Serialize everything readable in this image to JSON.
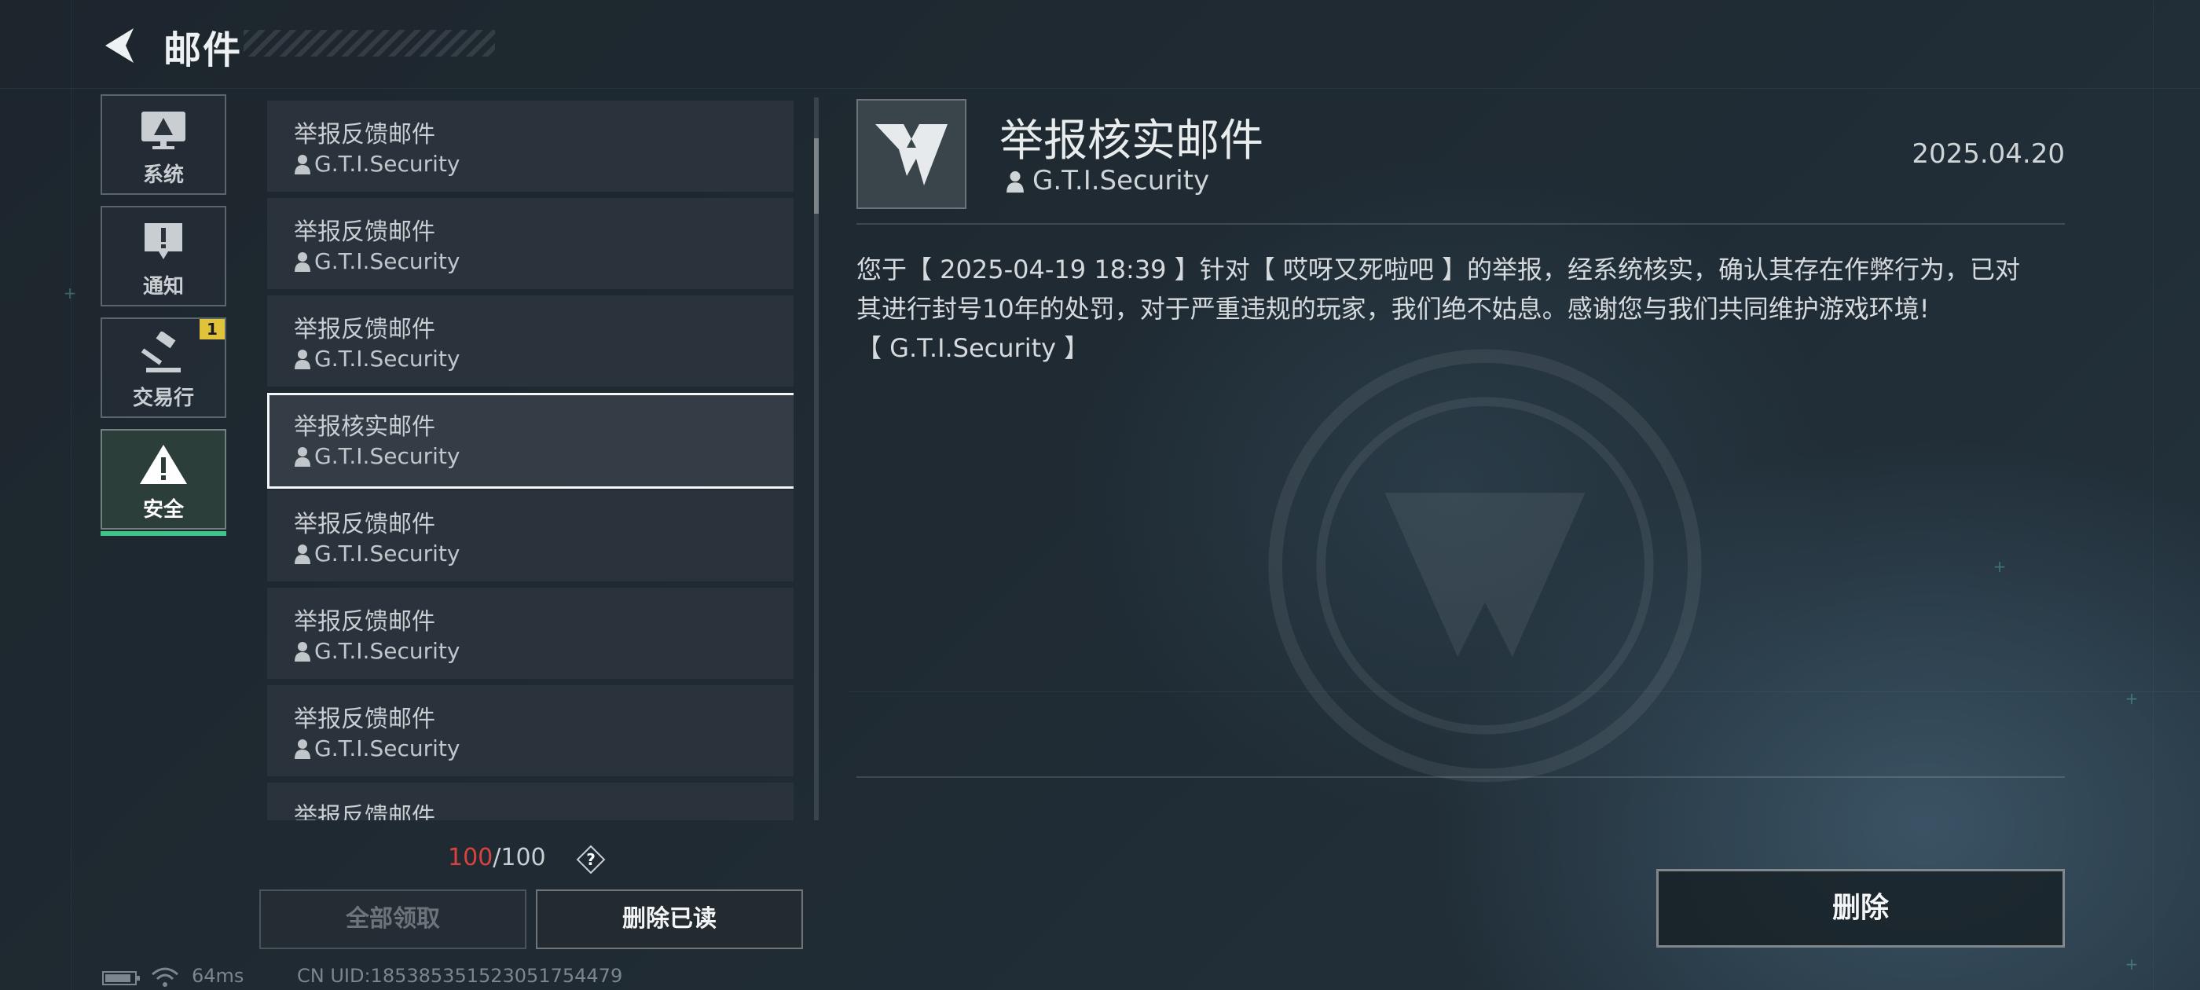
{
  "header": {
    "title": "邮件"
  },
  "categories": [
    {
      "label": "系统",
      "icon": "monitor-icon"
    },
    {
      "label": "通知",
      "icon": "notice-icon"
    },
    {
      "label": "交易行",
      "icon": "gavel-icon",
      "badge": "1"
    },
    {
      "label": "安全",
      "icon": "warning-icon",
      "active": true
    }
  ],
  "mail_list": [
    {
      "subject": "举报反馈邮件",
      "sender": "G.T.I.Security"
    },
    {
      "subject": "举报反馈邮件",
      "sender": "G.T.I.Security"
    },
    {
      "subject": "举报反馈邮件",
      "sender": "G.T.I.Security"
    },
    {
      "subject": "举报核实邮件",
      "sender": "G.T.I.Security",
      "selected": true
    },
    {
      "subject": "举报反馈邮件",
      "sender": "G.T.I.Security"
    },
    {
      "subject": "举报反馈邮件",
      "sender": "G.T.I.Security"
    },
    {
      "subject": "举报反馈邮件",
      "sender": "G.T.I.Security"
    },
    {
      "subject": "举报反馈邮件",
      "sender": ""
    }
  ],
  "mail_count": {
    "current": "100",
    "total": "/100",
    "help": "?"
  },
  "buttons": {
    "claim_all": "全部领取",
    "delete_read": "删除已读",
    "delete": "删除"
  },
  "status": {
    "ping": "64ms",
    "uid": "CN UID:185385351523051754479"
  },
  "detail": {
    "title": "举报核实邮件",
    "sender": "G.T.I.Security",
    "date": "2025.04.20",
    "body": [
      "您于【 2025-04-19 18:39 】针对【 哎呀又死啦吧 】的举报，经系统核实，确认其存在作弊行为，已对",
      "其进行封号10年的处罚，对于严重违规的玩家，我们绝不姑息。感谢您与我们共同维护游戏环境!",
      "【 G.T.I.Security 】"
    ]
  },
  "colors": {
    "accent_green": "#3fc48a",
    "badge_yellow": "#e0c33a",
    "count_red": "#d6443f"
  }
}
